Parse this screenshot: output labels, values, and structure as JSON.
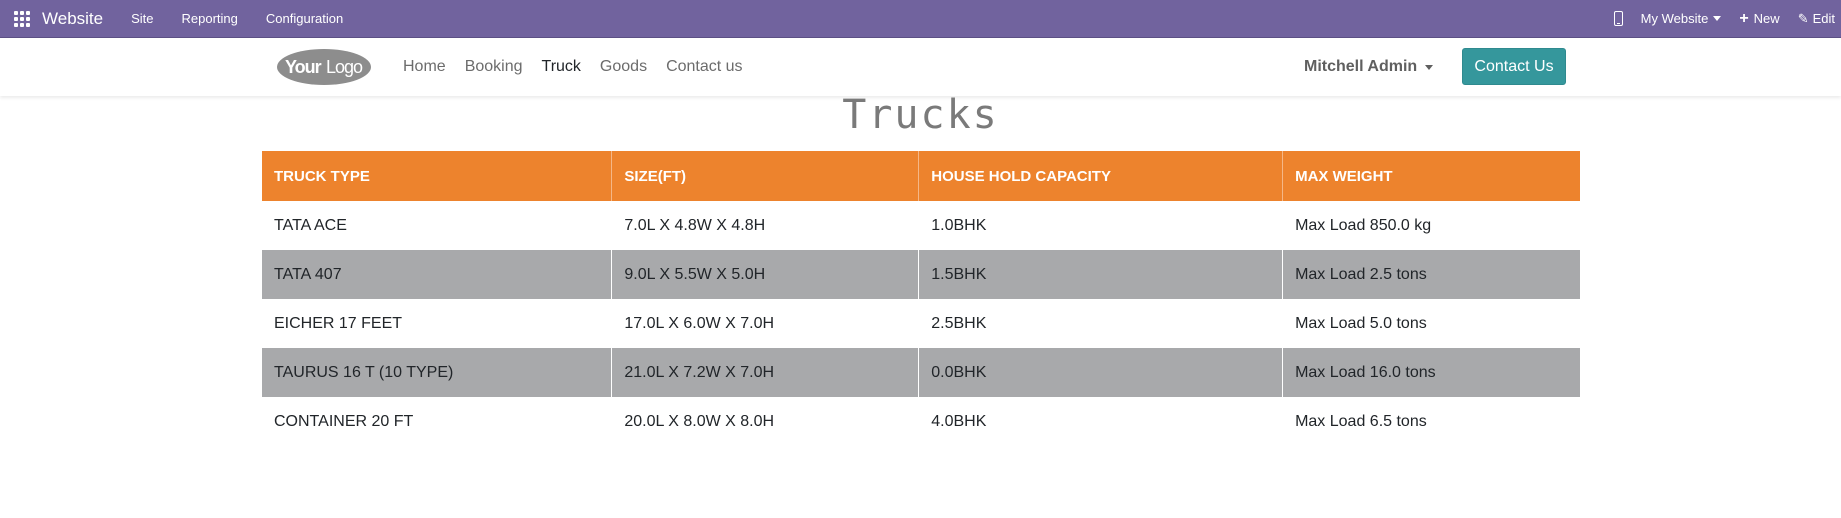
{
  "topbar": {
    "brand": "Website",
    "menu": [
      "Site",
      "Reporting",
      "Configuration"
    ],
    "website_switcher": "My Website",
    "new_label": "New",
    "edit_label": "Edit"
  },
  "sitenav": {
    "logo_text": "YourLogo",
    "links": [
      "Home",
      "Booking",
      "Truck",
      "Goods",
      "Contact us"
    ],
    "active_link": "Truck",
    "user": "Mitchell Admin",
    "contact_button": "Contact Us"
  },
  "page": {
    "title": "Trucks"
  },
  "table": {
    "headers": [
      "TRUCK TYPE",
      "SIZE(FT)",
      "HOUSE HOLD CAPACITY",
      "MAX WEIGHT"
    ],
    "rows": [
      [
        "TATA ACE",
        "7.0L X 4.8W X 4.8H",
        "1.0BHK",
        "Max Load 850.0 kg"
      ],
      [
        "TATA 407",
        "9.0L X 5.5W X 5.0H",
        "1.5BHK",
        "Max Load 2.5 tons"
      ],
      [
        "EICHER 17 FEET",
        "17.0L X 6.0W X 7.0H",
        "2.5BHK",
        "Max Load 5.0 tons"
      ],
      [
        "TAURUS 16 T (10 TYPE)",
        "21.0L X 7.2W X 7.0H",
        "0.0BHK",
        "Max Load 16.0 tons"
      ],
      [
        "CONTAINER 20 FT",
        "20.0L X 8.0W X 8.0H",
        "4.0BHK",
        "Max Load 6.5 tons"
      ]
    ]
  },
  "colors": {
    "topbar": "#71639e",
    "header": "#ed832d",
    "stripe": "#a8a9ab",
    "button": "#35979c"
  }
}
